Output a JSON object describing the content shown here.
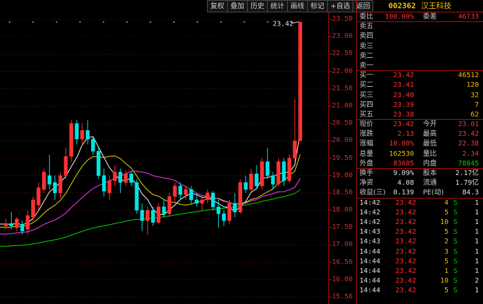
{
  "toolbar": {
    "buttons": [
      "复权",
      "叠加",
      "历史",
      "统计",
      "画线",
      "标记",
      "+自选",
      "返回"
    ]
  },
  "chart": {
    "price_axis_ticks": [
      "23.50",
      "23.00",
      "22.50",
      "22.00",
      "21.50",
      "21.00",
      "20.50",
      "20.00",
      "19.50",
      "19.00",
      "18.50",
      "18.00",
      "17.50",
      "17.00",
      "16.50",
      "16.00",
      "15.50"
    ],
    "high_marker_label": "23.42",
    "colors": {
      "up": "#ff3232",
      "down": "#00e5e5",
      "ma5": "#ffffff",
      "ma10": "#f0e000",
      "ma20": "#ff40ff",
      "ma60": "#00e000",
      "grid": "#b01010"
    }
  },
  "chart_data": {
    "type": "candlestick",
    "ylim": [
      15.3,
      23.7
    ],
    "candles": [
      {
        "o": 17.55,
        "h": 17.75,
        "l": 17.45,
        "c": 17.62
      },
      {
        "o": 17.62,
        "h": 17.95,
        "l": 17.45,
        "c": 17.55
      },
      {
        "o": 17.5,
        "h": 17.8,
        "l": 17.4,
        "c": 17.75
      },
      {
        "o": 17.6,
        "h": 17.7,
        "l": 17.3,
        "c": 17.4
      },
      {
        "o": 17.45,
        "h": 18.0,
        "l": 17.3,
        "c": 17.85
      },
      {
        "o": 17.8,
        "h": 18.4,
        "l": 17.7,
        "c": 18.3
      },
      {
        "o": 18.15,
        "h": 18.8,
        "l": 18.0,
        "c": 18.65
      },
      {
        "o": 18.6,
        "h": 19.2,
        "l": 18.5,
        "c": 19.1
      },
      {
        "o": 19.0,
        "h": 19.6,
        "l": 18.6,
        "c": 18.75
      },
      {
        "o": 18.8,
        "h": 19.0,
        "l": 18.3,
        "c": 18.5
      },
      {
        "o": 18.5,
        "h": 19.1,
        "l": 18.35,
        "c": 19.0
      },
      {
        "o": 19.0,
        "h": 19.8,
        "l": 18.9,
        "c": 19.55
      },
      {
        "o": 19.55,
        "h": 20.6,
        "l": 19.4,
        "c": 20.5
      },
      {
        "o": 20.5,
        "h": 20.6,
        "l": 19.9,
        "c": 20.05
      },
      {
        "o": 20.05,
        "h": 20.5,
        "l": 19.85,
        "c": 20.3
      },
      {
        "o": 20.3,
        "h": 20.6,
        "l": 19.9,
        "c": 20.05
      },
      {
        "o": 20.05,
        "h": 20.1,
        "l": 19.6,
        "c": 19.7
      },
      {
        "o": 19.7,
        "h": 19.8,
        "l": 18.9,
        "c": 19.0
      },
      {
        "o": 19.0,
        "h": 19.2,
        "l": 18.4,
        "c": 18.55
      },
      {
        "o": 18.5,
        "h": 19.0,
        "l": 18.3,
        "c": 18.85
      },
      {
        "o": 18.85,
        "h": 19.3,
        "l": 18.7,
        "c": 19.1
      },
      {
        "o": 19.1,
        "h": 19.2,
        "l": 18.5,
        "c": 18.8
      },
      {
        "o": 18.8,
        "h": 19.15,
        "l": 18.7,
        "c": 19.05
      },
      {
        "o": 19.05,
        "h": 19.1,
        "l": 18.7,
        "c": 18.8
      },
      {
        "o": 18.8,
        "h": 18.9,
        "l": 17.9,
        "c": 18.0
      },
      {
        "o": 18.0,
        "h": 18.2,
        "l": 17.4,
        "c": 17.7
      },
      {
        "o": 17.7,
        "h": 18.1,
        "l": 17.3,
        "c": 18.0
      },
      {
        "o": 18.0,
        "h": 18.1,
        "l": 17.55,
        "c": 17.65
      },
      {
        "o": 17.65,
        "h": 18.2,
        "l": 17.6,
        "c": 18.1
      },
      {
        "o": 18.1,
        "h": 18.3,
        "l": 17.8,
        "c": 17.9
      },
      {
        "o": 17.9,
        "h": 18.5,
        "l": 17.85,
        "c": 18.4
      },
      {
        "o": 18.4,
        "h": 18.8,
        "l": 18.2,
        "c": 18.7
      },
      {
        "o": 18.7,
        "h": 18.8,
        "l": 18.3,
        "c": 18.45
      },
      {
        "o": 18.45,
        "h": 18.7,
        "l": 18.3,
        "c": 18.6
      },
      {
        "o": 18.6,
        "h": 18.7,
        "l": 18.2,
        "c": 18.3
      },
      {
        "o": 18.3,
        "h": 18.5,
        "l": 18.1,
        "c": 18.2
      },
      {
        "o": 18.2,
        "h": 18.4,
        "l": 18.0,
        "c": 18.3
      },
      {
        "o": 18.3,
        "h": 18.6,
        "l": 18.2,
        "c": 18.5
      },
      {
        "o": 18.5,
        "h": 18.55,
        "l": 18.0,
        "c": 18.1
      },
      {
        "o": 18.1,
        "h": 18.3,
        "l": 17.5,
        "c": 17.9
      },
      {
        "o": 17.9,
        "h": 18.0,
        "l": 17.55,
        "c": 17.7
      },
      {
        "o": 17.7,
        "h": 18.3,
        "l": 17.6,
        "c": 18.2
      },
      {
        "o": 18.2,
        "h": 18.5,
        "l": 17.8,
        "c": 17.95
      },
      {
        "o": 17.95,
        "h": 18.9,
        "l": 17.9,
        "c": 18.8
      },
      {
        "o": 18.8,
        "h": 19.0,
        "l": 18.5,
        "c": 18.6
      },
      {
        "o": 18.6,
        "h": 19.2,
        "l": 18.55,
        "c": 19.05
      },
      {
        "o": 19.05,
        "h": 19.3,
        "l": 18.6,
        "c": 18.7
      },
      {
        "o": 18.7,
        "h": 19.5,
        "l": 18.6,
        "c": 19.4
      },
      {
        "o": 19.4,
        "h": 19.8,
        "l": 18.9,
        "c": 19.0
      },
      {
        "o": 19.0,
        "h": 19.1,
        "l": 18.6,
        "c": 18.75
      },
      {
        "o": 18.75,
        "h": 19.5,
        "l": 18.7,
        "c": 19.4
      },
      {
        "o": 19.4,
        "h": 19.5,
        "l": 18.7,
        "c": 18.85
      },
      {
        "o": 18.85,
        "h": 19.6,
        "l": 18.8,
        "c": 19.5
      },
      {
        "o": 19.5,
        "h": 21.2,
        "l": 19.4,
        "c": 20.0
      },
      {
        "o": 20.0,
        "h": 23.45,
        "l": 22.4,
        "c": 23.42
      }
    ]
  },
  "quote": {
    "code": "002362",
    "name": "汉王科技",
    "weibi_label": "委比",
    "weibi_value": "100.00%",
    "weicha_label": "委差",
    "weicha_value": "46733",
    "asks": [
      {
        "label": "卖五",
        "price": "",
        "vol": ""
      },
      {
        "label": "卖四",
        "price": "",
        "vol": ""
      },
      {
        "label": "卖三",
        "price": "",
        "vol": ""
      },
      {
        "label": "卖二",
        "price": "",
        "vol": ""
      },
      {
        "label": "卖一",
        "price": "",
        "vol": ""
      }
    ],
    "bids": [
      {
        "label": "买一",
        "price": "23.42",
        "vol": "46512"
      },
      {
        "label": "买二",
        "price": "23.41",
        "vol": "120"
      },
      {
        "label": "买三",
        "price": "23.40",
        "vol": "32"
      },
      {
        "label": "买四",
        "price": "23.39",
        "vol": "7"
      },
      {
        "label": "买五",
        "price": "23.38",
        "vol": "62"
      }
    ],
    "stats": [
      {
        "l1": "现价",
        "v1": "23.42",
        "c1": "red",
        "l2": "今开",
        "v2": "23.01",
        "c2": "red"
      },
      {
        "l1": "涨跌",
        "v1": "2.13",
        "c1": "red",
        "l2": "最高",
        "v2": "23.42",
        "c2": "red"
      },
      {
        "l1": "涨幅",
        "v1": "10.00%",
        "c1": "red",
        "l2": "最低",
        "v2": "22.38",
        "c2": "red"
      },
      {
        "l1": "总量",
        "v1": "162530",
        "c1": "yellow",
        "l2": "量比",
        "v2": "2.34",
        "c2": "red"
      },
      {
        "l1": "外盘",
        "v1": "83685",
        "c1": "red",
        "l2": "内盘",
        "v2": "78845",
        "c2": "green"
      }
    ],
    "fund": [
      {
        "l1": "换手",
        "v1": "9.09%",
        "l2": "股本",
        "v2": "2.17亿"
      },
      {
        "l1": "净资",
        "v1": "4.08",
        "l2": "流通",
        "v2": "1.79亿"
      },
      {
        "l1": "收益(三)",
        "v1": "0.139",
        "l2": "PE(动)",
        "v2": "84.3"
      }
    ],
    "trades": [
      {
        "time": "14:42",
        "price": "23.42",
        "vol": "4",
        "side": "S",
        "cnt": "1"
      },
      {
        "time": "14:42",
        "price": "23.42",
        "vol": "5",
        "side": "S",
        "cnt": "1"
      },
      {
        "time": "14:42",
        "price": "23.42",
        "vol": "10",
        "side": "S",
        "cnt": "1"
      },
      {
        "time": "14:43",
        "price": "23.42",
        "vol": "5",
        "side": "S",
        "cnt": "1"
      },
      {
        "time": "14:43",
        "price": "23.42",
        "vol": "2",
        "side": "S",
        "cnt": "1"
      },
      {
        "time": "14:44",
        "price": "23.42",
        "vol": "3",
        "side": "S",
        "cnt": "1"
      },
      {
        "time": "14:44",
        "price": "23.42",
        "vol": "5",
        "side": "S",
        "cnt": "1"
      },
      {
        "time": "14:44",
        "price": "23.42",
        "vol": "1",
        "side": "S",
        "cnt": "1"
      },
      {
        "time": "14:44",
        "price": "23.42",
        "vol": "10",
        "side": "S",
        "cnt": "2"
      },
      {
        "time": "14:44",
        "price": "23.42",
        "vol": "5",
        "side": "S",
        "cnt": "1"
      }
    ]
  }
}
